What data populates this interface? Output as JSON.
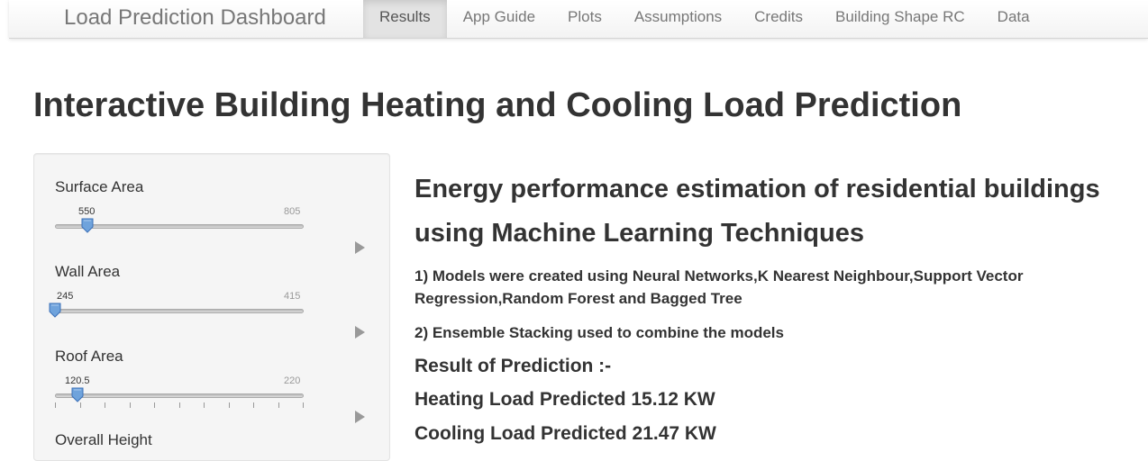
{
  "navbar": {
    "brand": "Load Prediction Dashboard",
    "tabs": [
      {
        "label": "Results",
        "active": true
      },
      {
        "label": "App Guide"
      },
      {
        "label": "Plots"
      },
      {
        "label": "Assumptions"
      },
      {
        "label": "Credits"
      },
      {
        "label": "Building Shape RC"
      },
      {
        "label": "Data"
      }
    ]
  },
  "page": {
    "title": "Interactive Building Heating and Cooling Load Prediction"
  },
  "sidebar": {
    "sliders": [
      {
        "label": "Surface Area",
        "value": "550",
        "max": "805",
        "level": 0.13
      },
      {
        "label": "Wall Area",
        "value": "245",
        "max": "415",
        "level": 0.0
      },
      {
        "label": "Roof Area",
        "value": "120.5",
        "max": "220",
        "level": 0.09,
        "ticks": 11
      }
    ],
    "next_label": "Overall Height"
  },
  "main": {
    "heading": "Energy performance estimation of residential buildings using Machine Learning Techniques",
    "point1": "1) Models were created using Neural Networks,K Nearest Neighbour,Support Vector Regression,Random Forest and Bagged Tree",
    "point2": "2) Ensemble Stacking used to combine the models",
    "result_title": "Result of Prediction :-",
    "heating": "Heating Load Predicted 15.12 KW",
    "cooling": "Cooling Load Predicted 21.47 KW"
  },
  "colors": {
    "handle": "#6fa3dc",
    "accent_active_tab": "#e3e3e3"
  },
  "icons": {
    "play": "play-icon"
  }
}
